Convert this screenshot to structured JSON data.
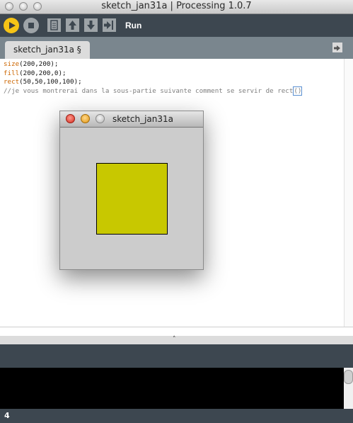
{
  "window": {
    "title": "sketch_jan31a | Processing 1.0.7"
  },
  "toolbar": {
    "run_label": "Run",
    "buttons": [
      "play-icon",
      "stop-icon",
      "new-file-icon",
      "open-icon",
      "save-icon",
      "export-icon"
    ],
    "accent": "#f6c416"
  },
  "tab": {
    "label": "sketch_jan31a §"
  },
  "code": {
    "line1": {
      "fn": "size",
      "rest": "(200,200);"
    },
    "line2": {
      "fn": "fill",
      "rest": "(200,200,0);"
    },
    "line3": {
      "fn": "rect",
      "rest": "(50,50,100,100);"
    },
    "line4": {
      "comment": "//je vous montrerai dans la sous-partie suivante comment se servir de rect",
      "tail": "()"
    }
  },
  "sketch_window": {
    "title": "sketch_jan31a",
    "background": "#cccccc",
    "rect_fill": "#c8c800"
  },
  "splitter": {
    "handle": "˄"
  },
  "status": {
    "line_number": "4"
  }
}
